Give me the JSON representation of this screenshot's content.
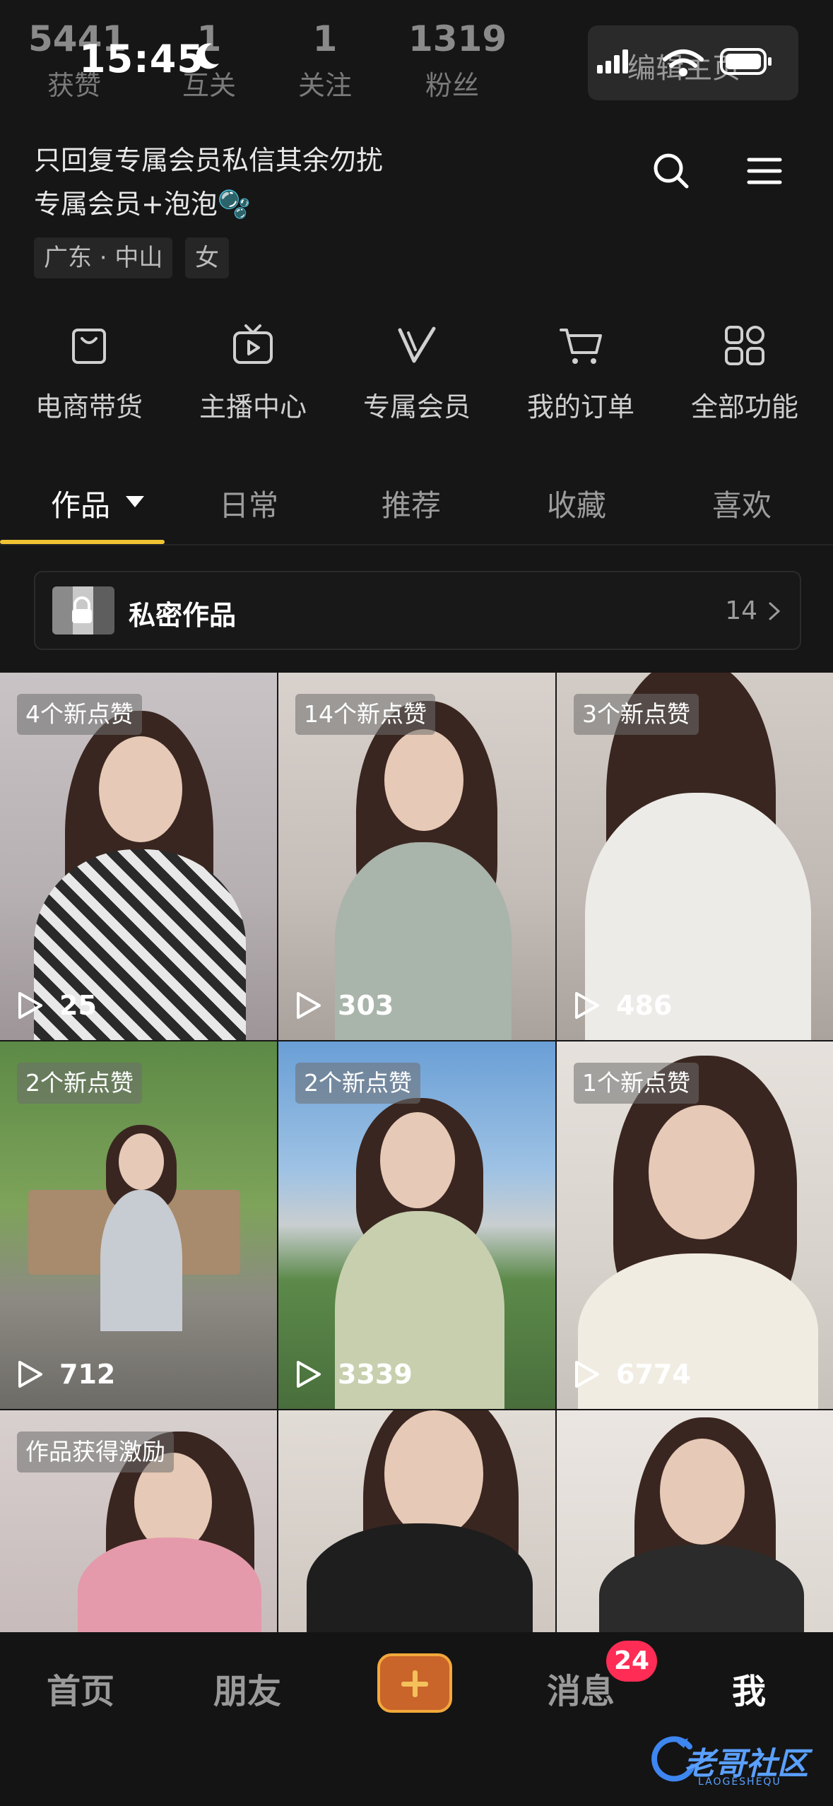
{
  "status": {
    "time": "15:45"
  },
  "profile": {
    "stats": [
      {
        "num": "5441",
        "label": "获赞"
      },
      {
        "num": "1",
        "label": "互关"
      },
      {
        "num": "1",
        "label": "关注"
      },
      {
        "num": "1319",
        "label": "粉丝"
      }
    ],
    "edit_label": "编辑主页",
    "bio_line1": "只回复专属会员私信其余勿扰",
    "bio_line2": "专属会员+泡泡🫧",
    "tags": [
      "广东 · 中山",
      "女"
    ]
  },
  "functions": [
    {
      "label": "电商带货",
      "icon": "shopping-bag-icon"
    },
    {
      "label": "主播中心",
      "icon": "tv-play-icon"
    },
    {
      "label": "专属会员",
      "icon": "v-icon"
    },
    {
      "label": "我的订单",
      "icon": "cart-icon"
    },
    {
      "label": "全部功能",
      "icon": "grid-icon"
    }
  ],
  "tabs": [
    "作品",
    "日常",
    "推荐",
    "收藏",
    "喜欢"
  ],
  "private_works": {
    "label": "私密作品",
    "count": "14"
  },
  "videos": [
    {
      "badge": "4个新点赞",
      "plays": "25"
    },
    {
      "badge": "14个新点赞",
      "plays": "303"
    },
    {
      "badge": "3个新点赞",
      "plays": "486"
    },
    {
      "badge": "2个新点赞",
      "plays": "712"
    },
    {
      "badge": "2个新点赞",
      "plays": "3339"
    },
    {
      "badge": "1个新点赞",
      "plays": "6774"
    },
    {
      "badge": "作品获得激励",
      "plays": ""
    },
    {
      "badge": "",
      "plays": ""
    },
    {
      "badge": "",
      "plays": ""
    }
  ],
  "nav": {
    "home": "首页",
    "friends": "朋友",
    "messages": "消息",
    "messages_badge": "24",
    "me": "我"
  },
  "watermark": {
    "text": "老哥社区",
    "sub": "LAOGESHEQU"
  },
  "colors": {
    "accent_underline": "#f1c232",
    "notif": "#ff2c55",
    "create": "#c9642a"
  }
}
